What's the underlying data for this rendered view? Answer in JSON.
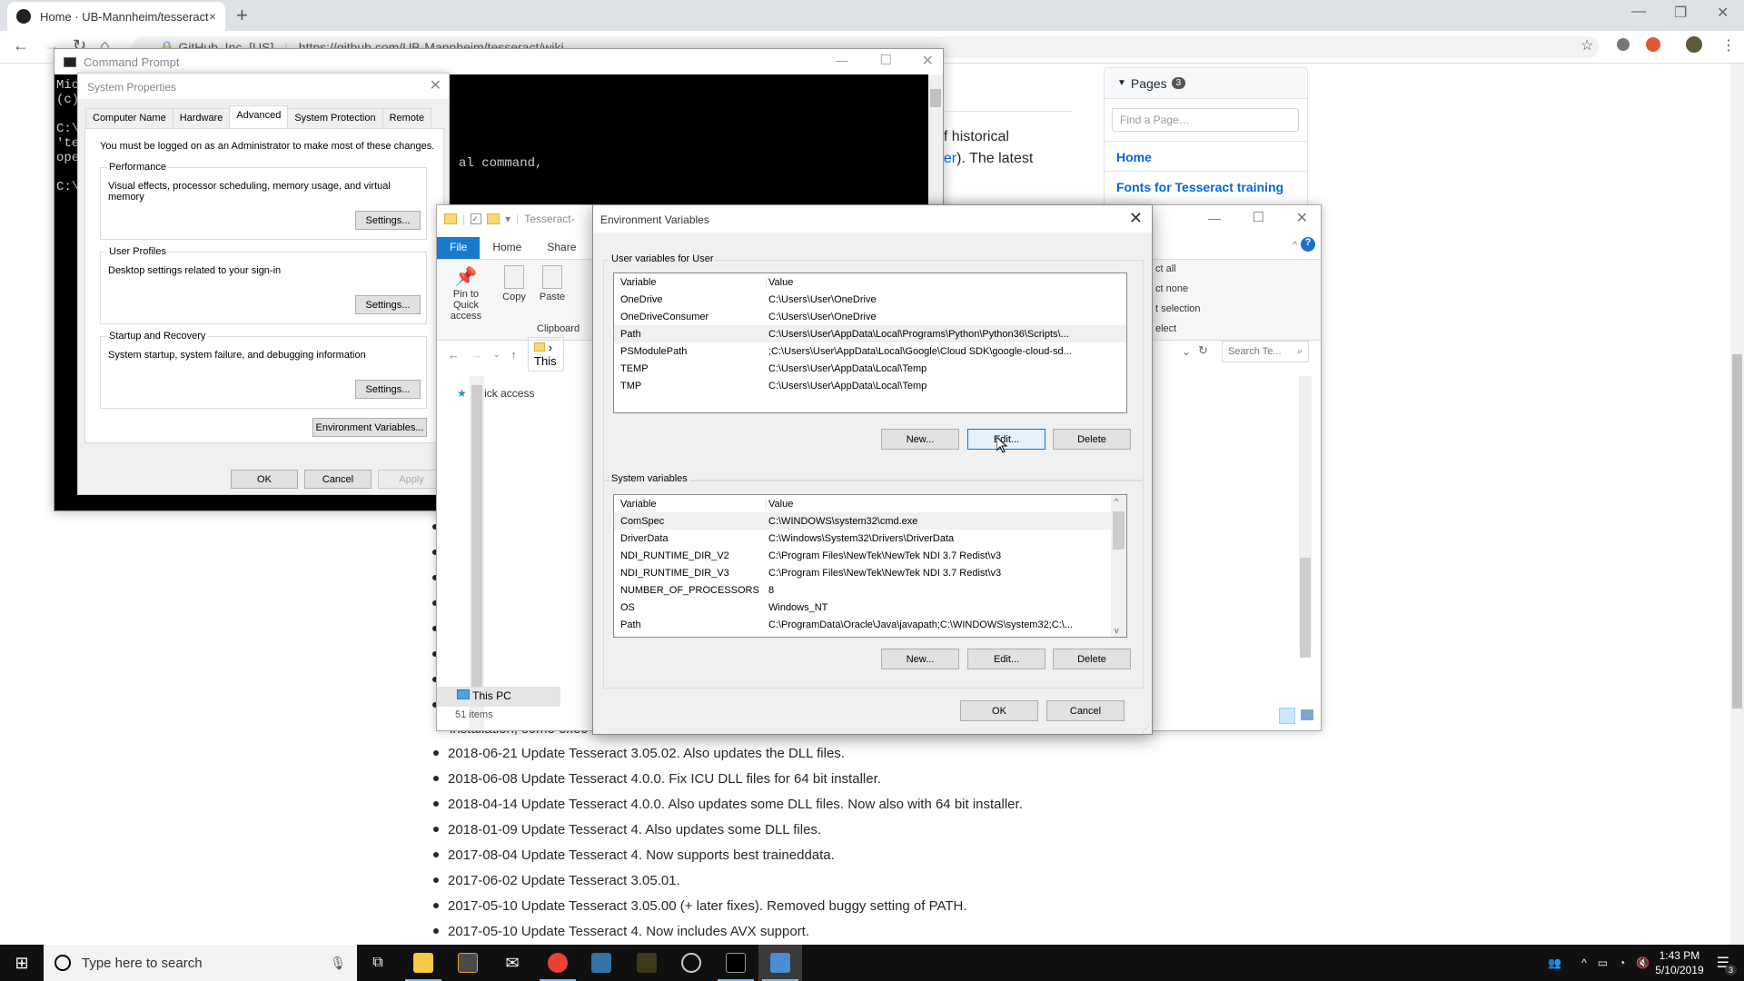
{
  "browser": {
    "tab_title": "Home · UB-Mannheim/tesseract",
    "tab_close": "×",
    "new_tab": "+",
    "site_identity": "GitHub, Inc. [US]",
    "url": "https://github.com/UB-Mannheim/tesseract/wiki",
    "win_minimize": "—",
    "win_restore": "❐",
    "win_close": "✕"
  },
  "wiki": {
    "text_line1": "of historical",
    "text_line2_link": "ger",
    "text_line2_rest": "). The latest",
    "pages_title": "Pages",
    "pages_count": "3",
    "find_placeholder": "Find a Page…",
    "page_links": [
      "Home",
      "Fonts for Tesseract training"
    ],
    "partial_line": "installation, some exec",
    "release_notes": [
      "2018-06-21 Update Tesseract 3.05.02. Also updates the DLL files.",
      "2018-06-08 Update Tesseract 4.0.0. Fix ICU DLL files for 64 bit installer.",
      "2018-04-14 Update Tesseract 4.0.0. Also updates some DLL files. Now also with 64 bit installer.",
      "2018-01-09 Update Tesseract 4. Also updates some DLL files.",
      "2017-08-04 Update Tesseract 4. Now supports best traineddata.",
      "2017-06-02 Update Tesseract 3.05.01.",
      "2017-05-10 Update Tesseract 3.05.00 (+ later fixes). Removed buggy setting of PATH.",
      "2017-05-10 Update Tesseract 4. Now includes AVX support."
    ]
  },
  "cmd": {
    "title": "Command Prompt",
    "lines": "Mic\n(c)\n\nC:\\\n'te\nope\n\nC:\\",
    "visible_fragment": "al command,"
  },
  "sysprop": {
    "title": "System Properties",
    "tabs": [
      "Computer Name",
      "Hardware",
      "Advanced",
      "System Protection",
      "Remote"
    ],
    "active_tab": "Advanced",
    "admin_notice": "You must be logged on as an Administrator to make most of these changes.",
    "performance": {
      "title": "Performance",
      "desc": "Visual effects, processor scheduling, memory usage, and virtual memory",
      "button": "Settings..."
    },
    "user_profiles": {
      "title": "User Profiles",
      "desc": "Desktop settings related to your sign-in",
      "button": "Settings..."
    },
    "startup": {
      "title": "Startup and Recovery",
      "desc": "System startup, system failure, and debugging information",
      "button": "Settings..."
    },
    "env_button": "Environment Variables...",
    "ok": "OK",
    "cancel": "Cancel",
    "apply": "Apply"
  },
  "explorer": {
    "title": "Tesseract-",
    "ribbon_tabs": [
      "File",
      "Home",
      "Share"
    ],
    "pin_label": "Pin to Quick access",
    "copy_label": "Copy",
    "paste_label": "Paste",
    "clipboard_group": "Clipboard",
    "select_all": "ct all",
    "select_none": "ct none",
    "invert_selection": "t selection",
    "select_group": "elect",
    "address": "This",
    "search_placeholder": "Search Te...",
    "quick_access": "Quick access",
    "this_pc": "This PC",
    "status": "51 items"
  },
  "envvars": {
    "title": "Environment Variables",
    "user_group": "User variables for User",
    "col_variable": "Variable",
    "col_value": "Value",
    "user_vars": [
      {
        "name": "OneDrive",
        "value": "C:\\Users\\User\\OneDrive"
      },
      {
        "name": "OneDriveConsumer",
        "value": "C:\\Users\\User\\OneDrive"
      },
      {
        "name": "Path",
        "value": "C:\\Users\\User\\AppData\\Local\\Programs\\Python\\Python36\\Scripts\\..."
      },
      {
        "name": "PSModulePath",
        "value": ";C:\\Users\\User\\AppData\\Local\\Google\\Cloud SDK\\google-cloud-sd..."
      },
      {
        "name": "TEMP",
        "value": "C:\\Users\\User\\AppData\\Local\\Temp"
      },
      {
        "name": "TMP",
        "value": "C:\\Users\\User\\AppData\\Local\\Temp"
      }
    ],
    "system_group": "System variables",
    "system_vars": [
      {
        "name": "ComSpec",
        "value": "C:\\WINDOWS\\system32\\cmd.exe"
      },
      {
        "name": "DriverData",
        "value": "C:\\Windows\\System32\\Drivers\\DriverData"
      },
      {
        "name": "NDI_RUNTIME_DIR_V2",
        "value": "C:\\Program Files\\NewTek\\NewTek NDI 3.7 Redist\\v3"
      },
      {
        "name": "NDI_RUNTIME_DIR_V3",
        "value": "C:\\Program Files\\NewTek\\NewTek NDI 3.7 Redist\\v3"
      },
      {
        "name": "NUMBER_OF_PROCESSORS",
        "value": "8"
      },
      {
        "name": "OS",
        "value": "Windows_NT"
      },
      {
        "name": "Path",
        "value": "C:\\ProgramData\\Oracle\\Java\\javapath;C:\\WINDOWS\\system32;C:\\..."
      }
    ],
    "new": "New...",
    "edit": "Edit...",
    "delete": "Delete",
    "ok": "OK",
    "cancel": "Cancel"
  },
  "taskbar": {
    "search_placeholder": "Type here to search",
    "time": "1:43 PM",
    "date": "5/10/2019",
    "notification_count": "3"
  }
}
